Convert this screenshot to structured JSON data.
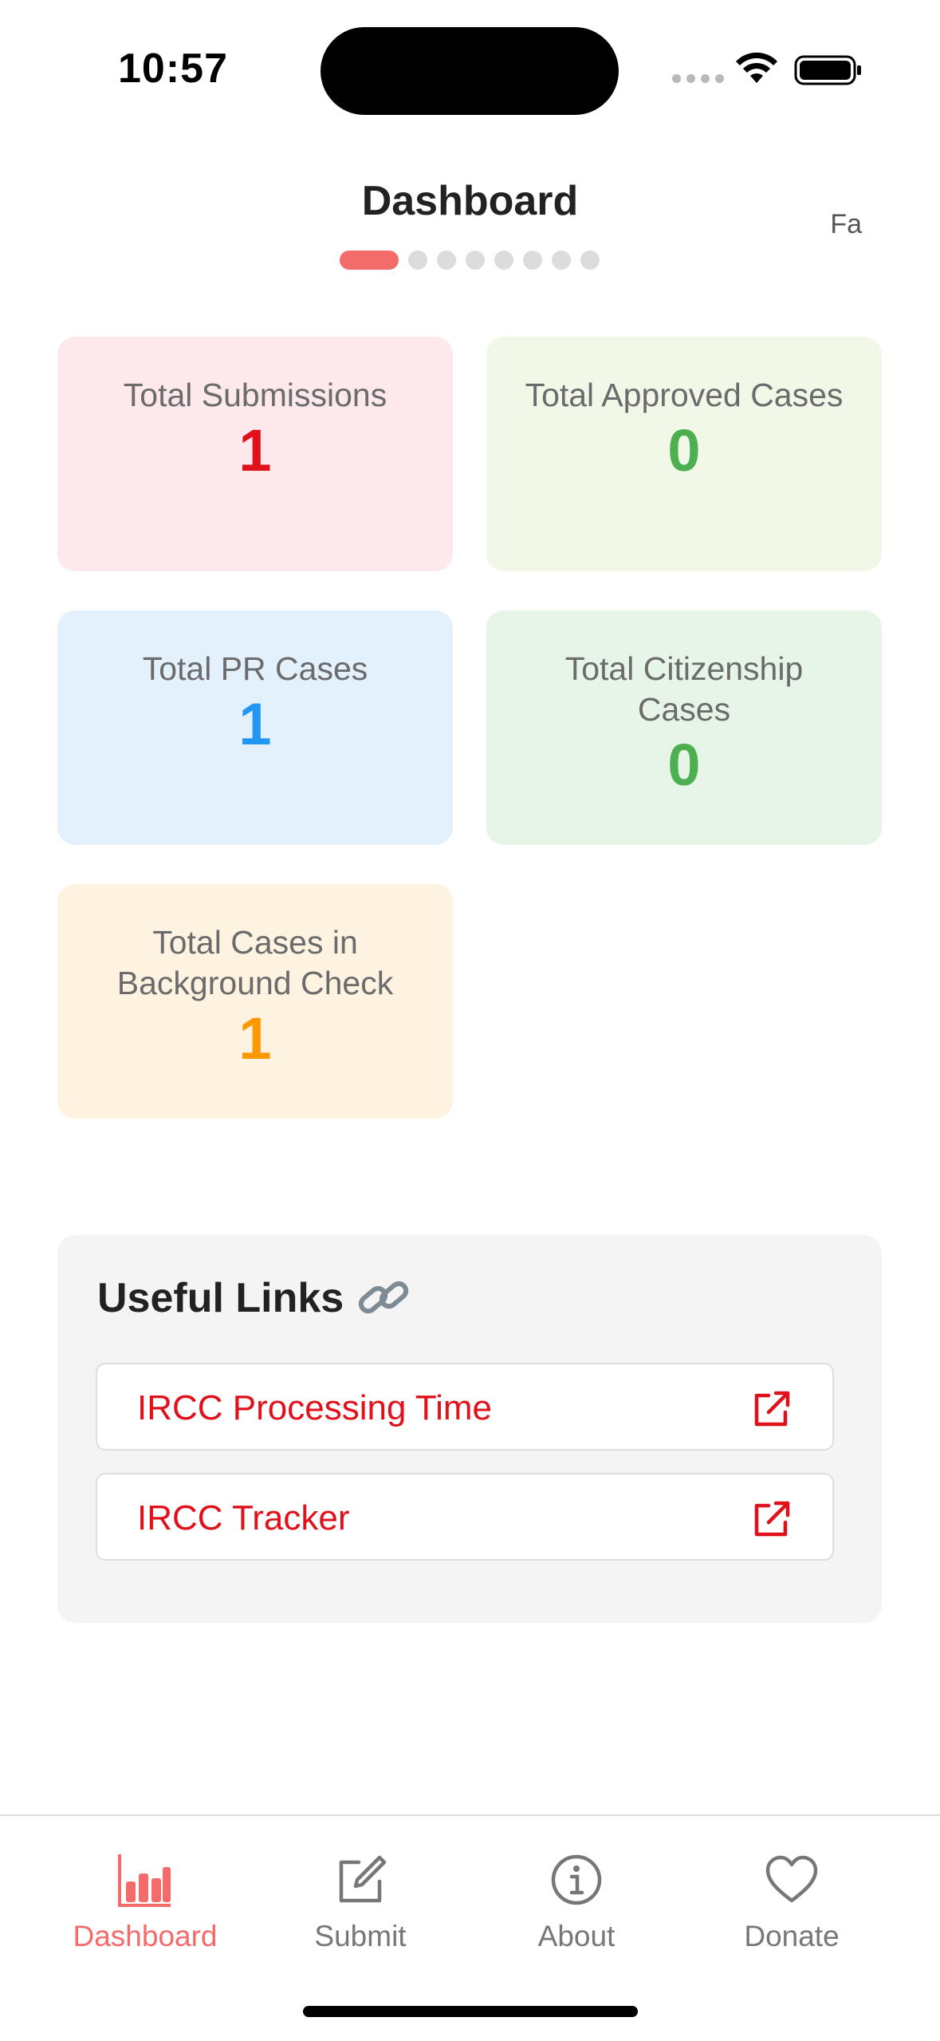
{
  "status_bar": {
    "time": "10:57",
    "battery_level": 1.0
  },
  "header": {
    "title": "Dashboard",
    "language_toggle": "Fa",
    "pager": {
      "total_pages": 8,
      "active_index": 0
    }
  },
  "stats": [
    {
      "label": "Total Submissions",
      "value": "1",
      "color": "#e1111b",
      "bg": "#fde8ec"
    },
    {
      "label": "Total Approved Cases",
      "value": "0",
      "color": "#4caf50",
      "bg": "#f1f8e8"
    },
    {
      "label": "Total PR Cases",
      "value": "1",
      "color": "#2196f3",
      "bg": "#e3f1fd"
    },
    {
      "label": "Total Citizenship Cases",
      "value": "0",
      "color": "#4caf50",
      "bg": "#e7f4e8"
    },
    {
      "label": "Total Cases in Background Check",
      "value": "1",
      "color": "#ff9800",
      "bg": "#fef2e1"
    }
  ],
  "useful_links": {
    "title": "Useful Links",
    "title_icon": "link-icon",
    "links": [
      {
        "label": "IRCC Processing Time",
        "icon": "external-link-icon"
      },
      {
        "label": "IRCC Tracker",
        "icon": "external-link-icon"
      }
    ]
  },
  "tab_bar": {
    "active": "Dashboard",
    "accent_color": "#f36b6b",
    "tabs": [
      {
        "label": "Dashboard",
        "icon": "bar-chart-icon"
      },
      {
        "label": "Submit",
        "icon": "edit-icon"
      },
      {
        "label": "About",
        "icon": "info-icon"
      },
      {
        "label": "Donate",
        "icon": "heart-icon"
      }
    ]
  }
}
